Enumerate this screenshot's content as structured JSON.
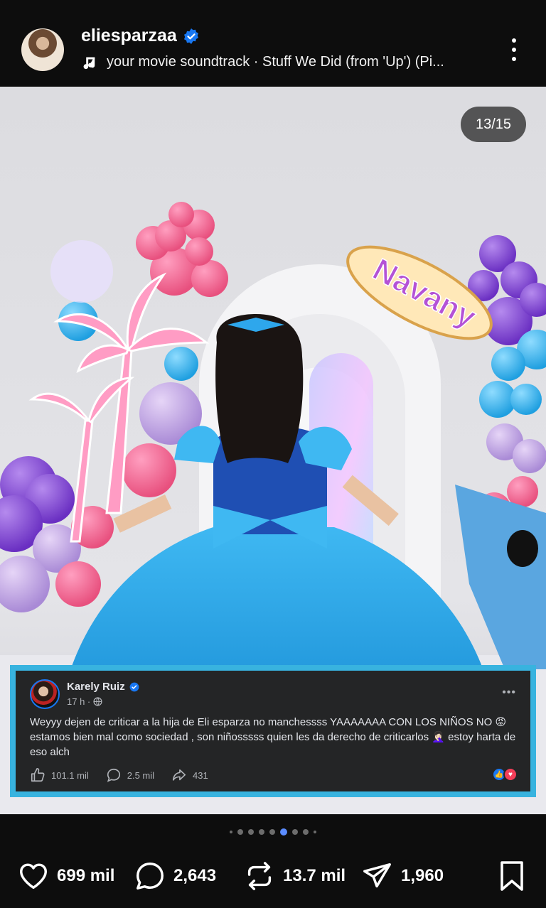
{
  "header": {
    "username": "eliesparzaa",
    "audio_label": "your movie soundtrack · Stuff We Did (from 'Up') (Pi..."
  },
  "photo": {
    "counter": "13/15",
    "sign_text": "Navany"
  },
  "comment_card": {
    "author": "Karely Ruiz",
    "time": "17 h ·",
    "text": "Weyyy dejen de criticar a la hija de Eli esparza no manchessss YAAAAAAA CON LOS NIÑOS NO 😡 estamos bien mal como sociedad , son niñosssss quien les da derecho de criticarlos 🤦🏻‍♀️ estoy harta de eso alch",
    "likes": "101.1 mil",
    "comments": "2.5 mil",
    "shares": "431",
    "more": "•••"
  },
  "carousel": {
    "total": 9,
    "active_index": 5
  },
  "actions": {
    "likes": "699 mil",
    "comments": "2,643",
    "reposts": "13.7 mil",
    "shares": "1,960"
  },
  "colors": {
    "accent_blue": "#38b3df",
    "verified": "#1877f2",
    "background": "#0d0d0d"
  },
  "icons": [
    "verified-icon",
    "music-note-icon",
    "more-vertical-icon",
    "heart-icon",
    "comment-icon",
    "repost-icon",
    "send-icon",
    "bookmark-icon",
    "like-icon",
    "share-icon",
    "globe-icon"
  ]
}
